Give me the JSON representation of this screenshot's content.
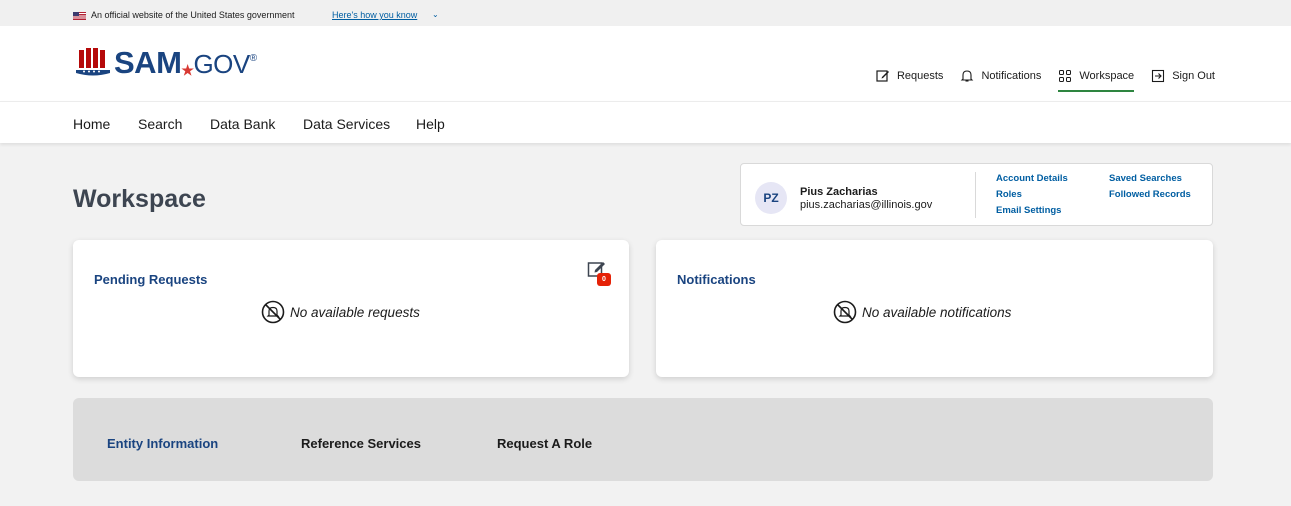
{
  "gov_banner": {
    "text": "An official website of the United States government",
    "link": "Here's how you know"
  },
  "header": {
    "logo": {
      "brand": "SAM",
      "suffix": "GOV",
      "mark": "®"
    },
    "utility_nav": [
      {
        "label": "Requests",
        "icon": "edit-icon"
      },
      {
        "label": "Notifications",
        "icon": "bell-icon"
      },
      {
        "label": "Workspace",
        "icon": "grid-icon",
        "active": true
      },
      {
        "label": "Sign Out",
        "icon": "sign-out-icon"
      }
    ]
  },
  "main_nav": [
    "Home",
    "Search",
    "Data Bank",
    "Data Services",
    "Help"
  ],
  "page": {
    "title": "Workspace"
  },
  "profile": {
    "initials": "PZ",
    "name": "Pius Zacharias",
    "email": "pius.zacharias@illinois.gov",
    "links_col1": [
      "Account Details",
      "Roles",
      "Email Settings"
    ],
    "links_col2": [
      "Saved Searches",
      "Followed Records"
    ]
  },
  "cards": {
    "pending": {
      "title": "Pending Requests",
      "empty": "No available requests",
      "badge_count": "0"
    },
    "notifications": {
      "title": "Notifications",
      "empty": "No available notifications"
    }
  },
  "bottom_tabs": [
    {
      "label": "Entity Information",
      "active": true
    },
    {
      "label": "Reference Services",
      "active": false
    },
    {
      "label": "Request A Role",
      "active": false
    }
  ],
  "colors": {
    "brand_navy": "#1a4480",
    "link_blue": "#005ea2",
    "active_green": "#2e8540",
    "badge_red": "#e52207"
  }
}
